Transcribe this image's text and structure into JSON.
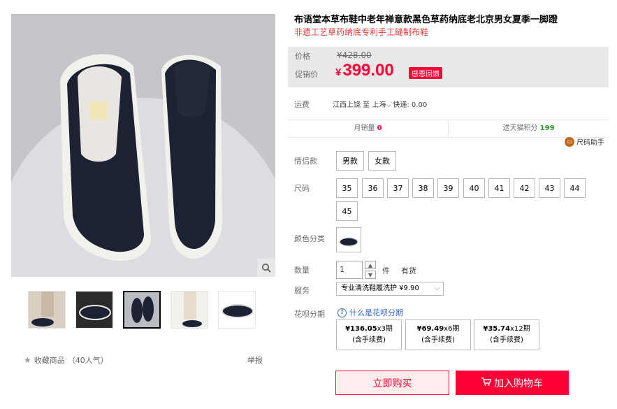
{
  "gallery": {
    "thumb_count": 5,
    "active_thumb": 3,
    "favorite_label": "收藏商品",
    "favorite_count": "（40人气）",
    "report_label": "举报",
    "zoom_icon": "magnifier-icon"
  },
  "product": {
    "title": "布语堂本草布鞋中老年禅意款黑色草药纳底老北京男女夏季一脚蹬",
    "subtitle": "非遗工艺草药纳底专利手工缝制布鞋"
  },
  "price": {
    "price_label": "价格",
    "original_price": "¥428.00",
    "promo_label": "促销价",
    "currency": "¥",
    "promo_value": "399.00",
    "promo_tag": "感恩回馈",
    "accent": "#ff0036"
  },
  "shipping": {
    "label": "运费",
    "text": "江西上饶 至 上海",
    "express": " 快递: 0.00"
  },
  "stats": {
    "monthly_sales_label": "月销量",
    "monthly_sales_value": "0",
    "points_label": "送天猫积分",
    "points_value": "199",
    "size_helper_label": "尺码助手"
  },
  "options": {
    "couple_label": "情侣款",
    "couple_options": [
      "男款",
      "女款"
    ],
    "size_label": "尺码",
    "sizes": [
      "35",
      "36",
      "37",
      "38",
      "39",
      "40",
      "41",
      "42",
      "43",
      "44",
      "45"
    ],
    "color_label": "颜色分类",
    "quantity_label": "数量",
    "quantity_value": "1",
    "unit": "件",
    "stock": "有货",
    "service_label": "服务",
    "service_value": "专业清洗鞋履洗护 ¥9.90"
  },
  "installments": {
    "label": "花呗分期",
    "help_text": "什么是花呗分期",
    "plans": [
      {
        "amount": "¥136.05",
        "periods": "x3期",
        "fee": "(含手续费)"
      },
      {
        "amount": "¥69.49",
        "periods": "x6期",
        "fee": "(含手续费)"
      },
      {
        "amount": "¥35.74",
        "periods": "x12期",
        "fee": "(含手续费)"
      }
    ]
  },
  "actions": {
    "buy_now": "立即购买",
    "add_to_cart": "加入购物车"
  }
}
